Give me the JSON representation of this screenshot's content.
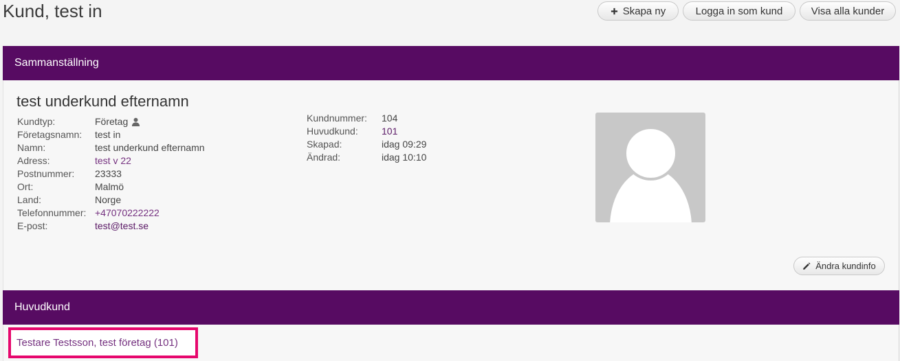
{
  "page": {
    "title": "Kund, test in"
  },
  "toolbar": {
    "create": {
      "label": "Skapa ny",
      "icon": "plus-icon"
    },
    "login": {
      "label": "Logga in som kund"
    },
    "show_all": {
      "label": "Visa alla kunder"
    }
  },
  "summary": {
    "header": "Sammanställning",
    "name": "test underkund efternamn",
    "details": [
      {
        "label": "Kundtyp:",
        "value": "Företag",
        "icon": "person-icon"
      },
      {
        "label": "Företagsnamn:",
        "value": "test in"
      },
      {
        "label": "Namn:",
        "value": "test underkund efternamn"
      },
      {
        "label": "Adress:",
        "value": "test v 22"
      },
      {
        "label": "Postnummer:",
        "value": "23333"
      },
      {
        "label": "Ort:",
        "value": "Malmö"
      },
      {
        "label": "Land:",
        "value": "Norge"
      },
      {
        "label": "Telefonnummer:",
        "value": "+47070222222"
      },
      {
        "label": "E-post:",
        "value": "test@test.se"
      }
    ],
    "meta": [
      {
        "label": "Kundnummer:",
        "value": "104"
      },
      {
        "label": "Huvudkund:",
        "value": "101"
      },
      {
        "label": "Skapad:",
        "value": "idag 09:29"
      },
      {
        "label": "Ändrad:",
        "value": "idag 10:10"
      }
    ],
    "avatar_icon": "user-silhouette-icon",
    "edit": {
      "label": "Ändra kundinfo",
      "icon": "pencil-icon"
    }
  },
  "parent_customer": {
    "header": "Huvudkund",
    "link": "Testare Testsson, test företag (101)"
  },
  "colors": {
    "header_bg": "#570b62",
    "link": "#74307f",
    "link_dark": "#5a1865",
    "highlight": "#e6076d",
    "page_bg": "#f4f4f4",
    "panel_bg": "#f7f7f7"
  }
}
